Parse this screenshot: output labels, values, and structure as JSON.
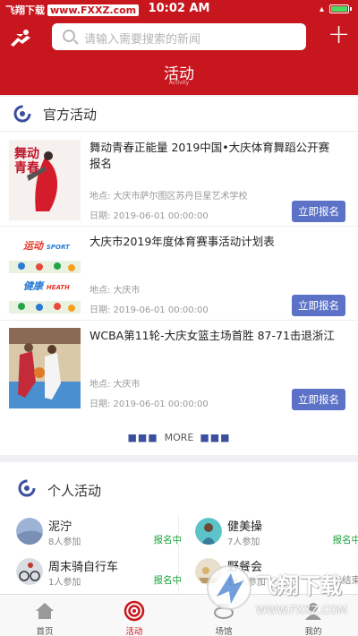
{
  "status_bar": {
    "carrier": "飞翔下载",
    "carrier_url": "www.FXXZ.com",
    "time": "10:02 AM"
  },
  "header": {
    "search_placeholder": "请输入需要搜索的新闻",
    "title": "活动",
    "subtitle": "Activity"
  },
  "official": {
    "title": "官方活动",
    "events": [
      {
        "title": "舞动青春正能量 2019中国•大庆体育舞蹈公开赛报名",
        "location": "地点: 大庆市萨尔图区苏丹巨星艺术学校",
        "date": "日期: 2019-06-01 00:00:00",
        "button": "立即报名",
        "thumb_text": "舞动青春"
      },
      {
        "title": "大庆市2019年度体育赛事活动计划表",
        "location": "地点: 大庆市",
        "date": "日期: 2019-06-01 00:00:00",
        "button": "立即报名",
        "thumb_text_1": "运动",
        "thumb_text_1b": "SPORT",
        "thumb_text_2": "健康",
        "thumb_text_2b": "HEATH"
      },
      {
        "title": "WCBA第11轮-大庆女篮主场首胜 87-71击退浙江",
        "location": "地点: 大庆市",
        "date": "日期: 2019-06-01 00:00:00",
        "button": "立即报名"
      }
    ],
    "more_label": "MORE",
    "more_dots": "■■■"
  },
  "personal": {
    "title": "个人活动",
    "items": [
      {
        "name": "泥泞",
        "count": "8人参加",
        "status": "报名中",
        "status_color": "#1aa33a"
      },
      {
        "name": "健美操",
        "count": "7人参加",
        "status": "报名中",
        "status_color": "#1aa33a"
      },
      {
        "name": "周末骑自行车",
        "count": "1人参加",
        "status": "报名中",
        "status_color": "#1aa33a"
      },
      {
        "name": "野餐会",
        "count": "15人参加",
        "status": "已结束",
        "status_color": "#888888"
      }
    ]
  },
  "tabbar": {
    "tabs": [
      {
        "label": "首页",
        "icon": "home-icon"
      },
      {
        "label": "活动",
        "icon": "target-icon"
      },
      {
        "label": "场馆",
        "icon": "stadium-icon"
      },
      {
        "label": "我的",
        "icon": "user-icon"
      }
    ]
  },
  "watermark": {
    "text": "飞翔下载",
    "url": "WWW.FXXZ.COM"
  },
  "colors": {
    "brand_red": "#c8161e",
    "button_blue": "#5b72c7",
    "section_icon_blue": "#3b4f9e"
  }
}
